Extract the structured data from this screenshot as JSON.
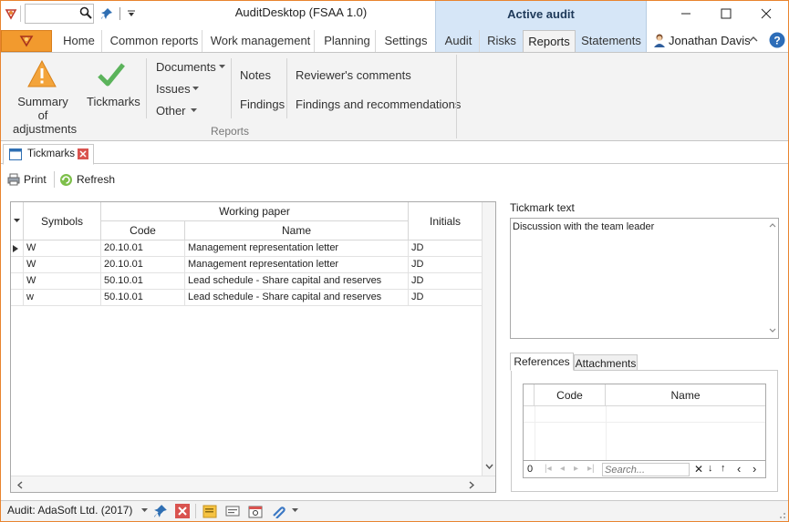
{
  "titlebar": {
    "app_title": "AuditDesktop (FSAA 1.0)",
    "context_tab": "Active audit",
    "search_value": ""
  },
  "tabs": {
    "home": "Home",
    "common_reports": "Common reports",
    "work_management": "Work management",
    "planning": "Planning",
    "settings": "Settings",
    "audit": "Audit",
    "risks": "Risks",
    "reports": "Reports",
    "statements": "Statements"
  },
  "user": {
    "name": "Jonathan Davis"
  },
  "ribbon": {
    "summary_line1": "Summary of",
    "summary_line2": "adjustments",
    "tickmarks": "Tickmarks",
    "documents": "Documents",
    "issues": "Issues",
    "other": "Other",
    "notes": "Notes",
    "findings": "Findings",
    "reviewers_comments": "Reviewer's comments",
    "findings_recommendations": "Findings and recommendations",
    "group_reports": "Reports"
  },
  "doc_tab": {
    "label": "Tickmarks"
  },
  "toolbar": {
    "print": "Print",
    "refresh": "Refresh"
  },
  "grid": {
    "headers": {
      "symbols": "Symbols",
      "working_paper": "Working paper",
      "code": "Code",
      "name": "Name",
      "initials": "Initials"
    },
    "rows": [
      {
        "symbol": "W",
        "code": "20.10.01",
        "name": "Management representation letter",
        "initials": "JD"
      },
      {
        "symbol": "W",
        "code": "20.10.01",
        "name": "Management representation letter",
        "initials": "JD"
      },
      {
        "symbol": "W",
        "code": "50.10.01",
        "name": "Lead schedule - Share capital and reserves",
        "initials": "JD"
      },
      {
        "symbol": "w",
        "code": "50.10.01",
        "name": "Lead schedule - Share capital and reserves",
        "initials": "JD"
      }
    ]
  },
  "tickmark_text": {
    "label": "Tickmark text",
    "value": "Discussion with the team leader"
  },
  "references": {
    "tab_references": "References",
    "tab_attachments": "Attachments",
    "col_code": "Code",
    "col_name": "Name",
    "nav_count": "0",
    "search_placeholder": "Search..."
  },
  "status": {
    "audit": "Audit: AdaSoft Ltd. (2017)"
  },
  "colors": {
    "accent": "#f29a2e",
    "context": "#d6e6f7",
    "ribbon": "#f3f3f3",
    "frame": "#e8842f"
  }
}
